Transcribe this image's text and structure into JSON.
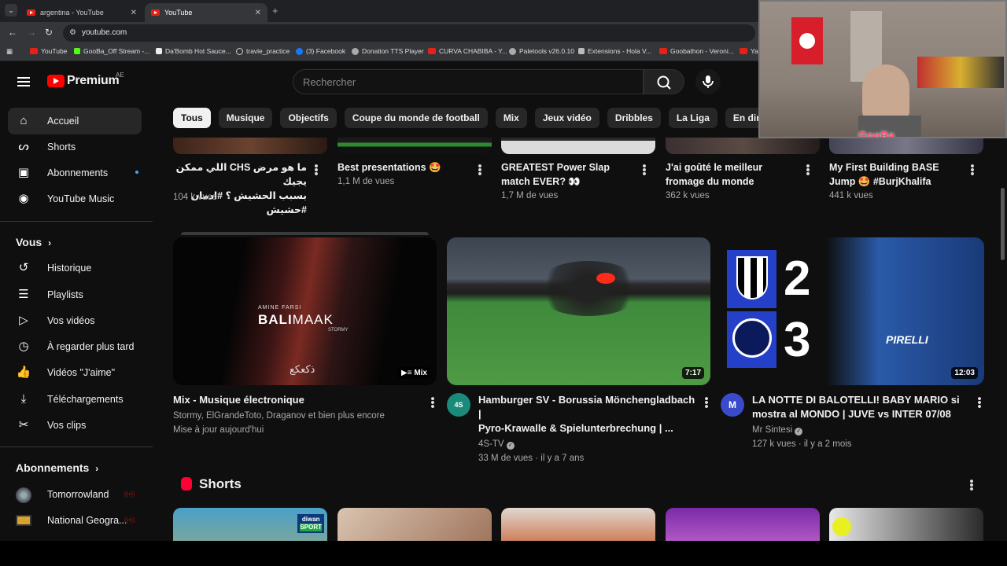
{
  "browser": {
    "tabs": [
      {
        "title": "argentina - YouTube"
      },
      {
        "title": "YouTube"
      }
    ],
    "url": "youtube.com",
    "bookmarks": [
      "YouTube",
      "GooBa_Off Stream -...",
      "Da'Bomb Hot Sauce...",
      "travle_practice",
      "(3) Facebook",
      "Donation TTS Player",
      "CURVA CHABIBA - Y...",
      "Paletools v26.0.10",
      "Extensions - Hola V...",
      "Goobathon - Veroni...",
      "Ya"
    ]
  },
  "header": {
    "logo": "Premium",
    "country": "AE",
    "search_placeholder": "Rechercher"
  },
  "sidebar": {
    "main": [
      "Accueil",
      "Shorts",
      "Abonnements",
      "YouTube Music"
    ],
    "you_title": "Vous",
    "you": [
      "Historique",
      "Playlists",
      "Vos vidéos",
      "À regarder plus tard",
      "Vidéos \"J'aime\"",
      "Téléchargements",
      "Vos clips"
    ],
    "subs_title": "Abonnements",
    "subs": [
      "Tomorrowland",
      "National Geogra..."
    ]
  },
  "chips": [
    "Tous",
    "Musique",
    "Objectifs",
    "Coupe du monde de football",
    "Mix",
    "Jeux vidéo",
    "Dribbles",
    "La Liga",
    "En direct"
  ],
  "row1": [
    {
      "title1": "ما هو مرض CHS اللي ممكن يجيك",
      "title2": "بسبب الحشيش ؟ #ادمان #حشيش",
      "meta": "104 k vues"
    },
    {
      "title1": "Best presentations 🤩",
      "title2": "",
      "meta": "1,1 M de vues"
    },
    {
      "title1": "GREATEST Power Slap",
      "title2": "match EVER? 👀",
      "meta": "1,7 M de vues"
    },
    {
      "title1": "J'ai goûté le meilleur",
      "title2": "fromage du monde",
      "meta": "362 k vues"
    },
    {
      "title1": "My First Building BASE",
      "title2": "Jump 🤩 #BurjKhalifa",
      "meta": "441 k vues"
    }
  ],
  "row2": [
    {
      "title1": "Mix - Musique électronique",
      "title2": "",
      "line1": "Stormy, ElGrandeToto, Draganov et bien plus encore",
      "line2": "Mise à jour aujourd'hui",
      "badge": "Mix",
      "thumb_artist": "AMINE FARSI",
      "thumb_title1": "BALI",
      "thumb_title2": "MAAK",
      "thumb_sub": "STORMY",
      "thumb_script": "ذكعكع"
    },
    {
      "title1": "Hamburger SV - Borussia Mönchengladbach |",
      "title2": "Pyro-Krawalle & Spielunterbrechung | ...",
      "line1": "4S-TV",
      "line2": "33 M de vues · il y a 7 ans",
      "badge": "7:17",
      "avatar": "4S"
    },
    {
      "title1": "LA NOTTE DI BALOTELLI! BABY MARIO si",
      "title2": "mostra al MONDO | JUVE vs INTER 07/08",
      "line1": "Mr Sintesi",
      "line2": "127 k vues · il y a 2 mois",
      "badge": "12:03",
      "score1": "2",
      "score2": "3",
      "shirt": "PIRELLI",
      "avatar": "M"
    }
  ],
  "shorts_title": "Shorts",
  "shorts_thumb_text": [
    "diwan",
    "SPORT"
  ],
  "overlay": {
    "name": "GooBa"
  },
  "colors": {
    "bg": "#0f0f0f",
    "accent": "#ff0000",
    "chip_active": "#f1f1f1",
    "link": "#3ea6ff"
  }
}
